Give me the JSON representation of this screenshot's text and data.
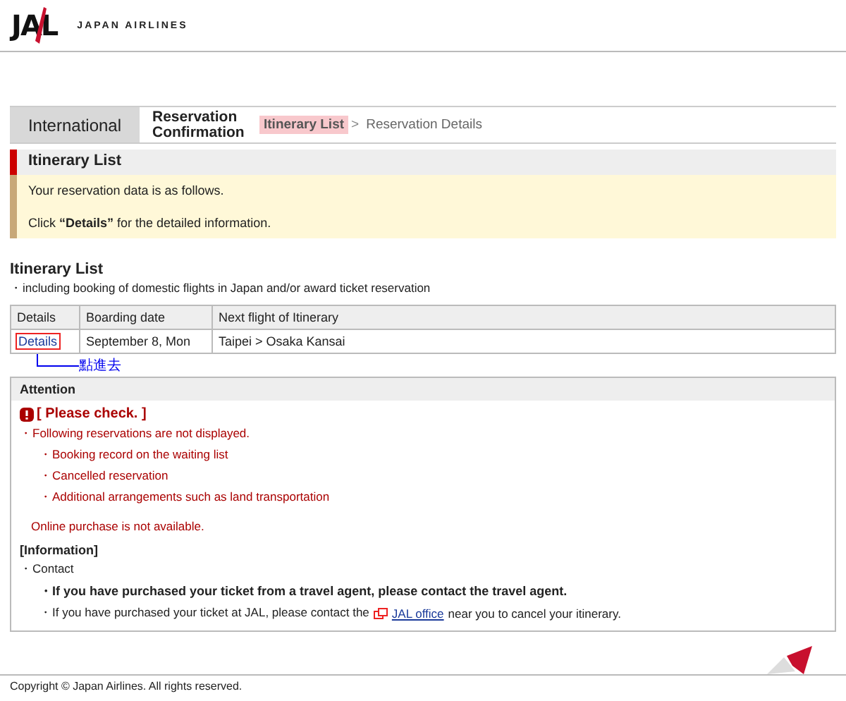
{
  "header": {
    "logo": "JAL",
    "brand": "JAPAN AIRLINES"
  },
  "nav": {
    "section": "International",
    "page": "Reservation Confirmation",
    "steps": [
      {
        "label": "Itinerary List",
        "selected": true
      },
      {
        "label": "Reservation Details",
        "selected": false
      }
    ],
    "separator": ">"
  },
  "intro": {
    "title": "Itinerary List",
    "lines": [
      "Your reservation data is as follows.",
      "Click **“Details”** for the detailed information."
    ]
  },
  "itinerary": {
    "title": "Itinerary List",
    "note": "・including booking of domestic flights in Japan and/or award ticket reservation",
    "columns": [
      "Details",
      "Boarding date",
      "Next flight of Itinerary"
    ],
    "rows": [
      {
        "link": "Details",
        "date": "September 8, Mon",
        "flight": "Taipei > Osaka Kansai"
      }
    ],
    "annotation": "點進去"
  },
  "attention": {
    "title": "Attention",
    "check": "[ Please check. ]",
    "items": [
      {
        "text": "・Following reservations are not displayed.",
        "children": [
          {
            "text": "・Booking record on the waiting list"
          },
          {
            "text": "・Cancelled reservation"
          },
          {
            "text": "・Additional arrangements such as land transportation"
          }
        ]
      }
    ],
    "online": "Online purchase is not available.",
    "info_title": "[Information]",
    "info": [
      {
        "text": "・Contact",
        "children": [
          {
            "kind": "bold",
            "text": "・If you have purchased your ticket from a travel agent, please contact the travel agent."
          },
          {
            "kind": "link",
            "before": "・If you have purchased your ticket at JAL, please contact the",
            "link": "JAL office",
            "after": "near you to cancel your itinerary."
          }
        ]
      }
    ]
  },
  "footer": {
    "copyright": "Copyright © Japan Airlines. All rights reserved."
  }
}
